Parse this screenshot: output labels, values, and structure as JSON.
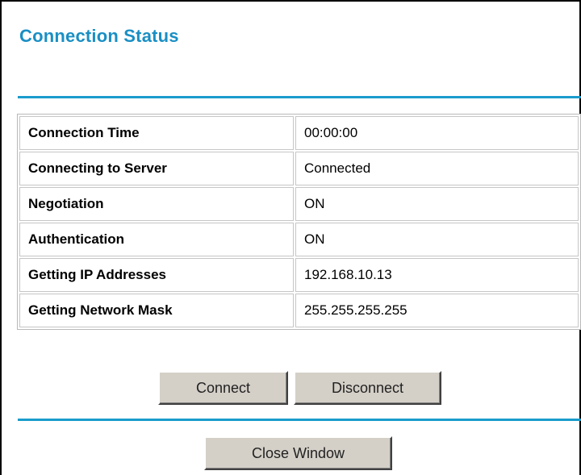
{
  "header": {
    "title": "Connection Status"
  },
  "status": {
    "rows": [
      {
        "label": "Connection Time",
        "value": "00:00:00"
      },
      {
        "label": "Connecting to Server",
        "value": "Connected"
      },
      {
        "label": "Negotiation",
        "value": "ON"
      },
      {
        "label": "Authentication",
        "value": "ON"
      },
      {
        "label": "Getting IP Addresses",
        "value": "192.168.10.13"
      },
      {
        "label": "Getting Network Mask",
        "value": "255.255.255.255"
      }
    ]
  },
  "actions": {
    "connect_label": "Connect",
    "disconnect_label": "Disconnect",
    "close_label": "Close Window"
  },
  "colors": {
    "accent": "#1a8fc4",
    "rule": "#1a9ccc",
    "button_face": "#d4d0c8",
    "cell_border": "#c6c6c6"
  }
}
